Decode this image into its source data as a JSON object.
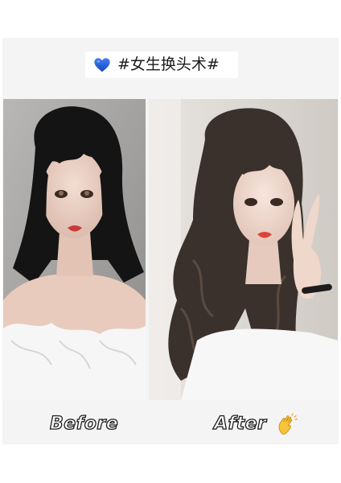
{
  "title": {
    "icon": "blue-heart-icon",
    "text": "#女生换头术#"
  },
  "photos": [
    {
      "name": "before-photo",
      "hair": "short dark layered hair with bangs"
    },
    {
      "name": "after-photo",
      "hair": "long wavy ponytail with bangs"
    }
  ],
  "labels": {
    "before": "Before",
    "after": "After",
    "after_icon": "clapping-hands-icon"
  },
  "colors": {
    "heart": "#1f5bd6",
    "card": "#f4f4f4",
    "caption_stroke": "#1b1b1b"
  }
}
